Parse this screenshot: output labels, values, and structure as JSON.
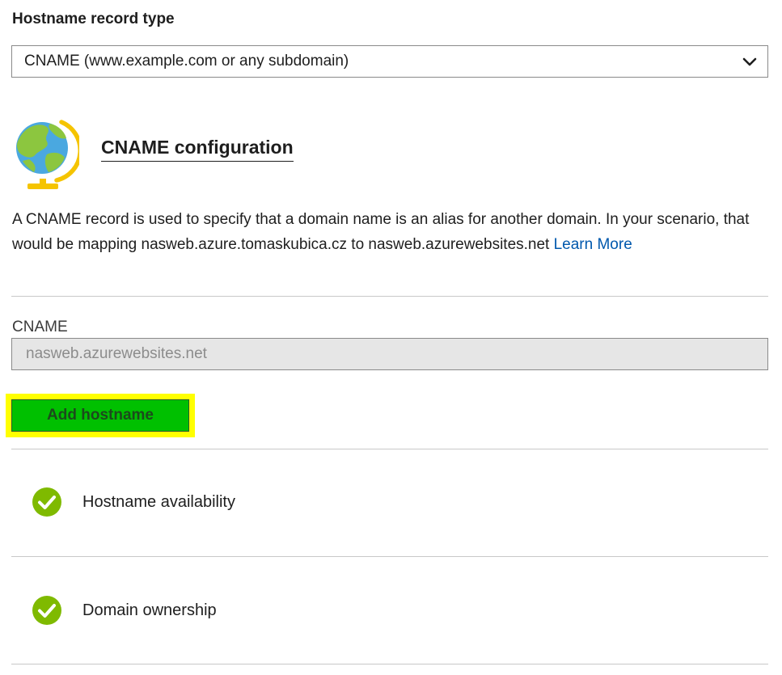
{
  "record_type": {
    "label": "Hostname record type",
    "selected": "CNAME (www.example.com or any subdomain)"
  },
  "cname_section": {
    "title": "CNAME configuration",
    "description": "A CNAME record is used to specify that a domain name is an alias for another domain. In your scenario, that would be mapping nasweb.azure.tomaskubica.cz to nasweb.azurewebsites.net ",
    "learn_more": "Learn More",
    "cname_label": "CNAME",
    "cname_value": "nasweb.azurewebsites.net",
    "add_button": "Add hostname"
  },
  "checks": [
    {
      "label": "Hostname availability"
    },
    {
      "label": "Domain ownership"
    }
  ],
  "colors": {
    "button_green": "#00c000",
    "highlight_yellow": "#ffff00",
    "check_green": "#7fba00",
    "link_blue": "#0058ad"
  }
}
